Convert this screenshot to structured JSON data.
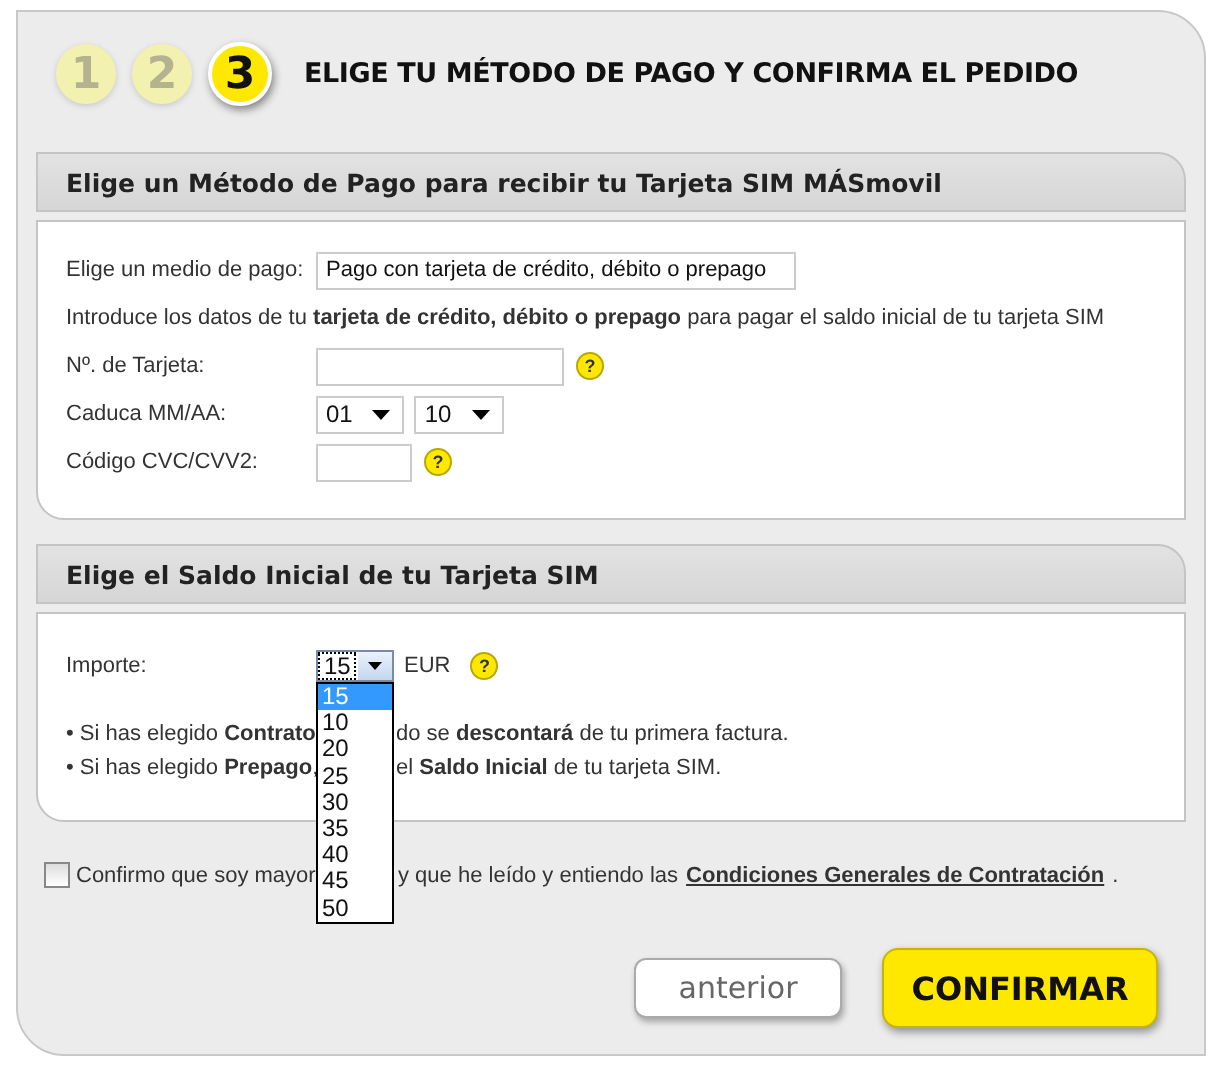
{
  "steps": [
    {
      "label": "1",
      "selected": false
    },
    {
      "label": "2",
      "selected": false
    },
    {
      "label": "3",
      "selected": true
    }
  ],
  "title": "ELIGE TU MÉTODO DE PAGO Y CONFIRMA EL PEDIDO",
  "payment_section": {
    "heading": "Elige un Método de Pago para recibir tu Tarjeta SIM MÁSmovil",
    "method": {
      "label": "Elige un medio de pago:",
      "value": "Pago con tarjeta de crédito, débito o prepago"
    },
    "instructions": "Introduce los datos de tu **tarjeta de crédito, débito o prepago** para pagar el saldo inicial de tu tarjeta SIM",
    "card_number": {
      "label": "Nº. de Tarjeta:",
      "help": "?"
    },
    "expiry": {
      "label": "Caduca MM/AA:",
      "month": "01",
      "year": "10"
    },
    "cvc": {
      "label": "Código CVC/CVV2:",
      "help": "?"
    }
  },
  "balance_section": {
    "heading": "Elige el Saldo Inicial de tu Tarjeta SIM",
    "amount": {
      "label": "Importe:",
      "value": "15",
      "unit": "EUR",
      "help": "?",
      "expanded": true,
      "options": [
        {
          "label": "15",
          "selected": true
        },
        {
          "label": "10",
          "selected": false
        },
        {
          "label": "20",
          "selected": false
        },
        {
          "label": "25",
          "selected": false
        },
        {
          "label": "30",
          "selected": false
        },
        {
          "label": "35",
          "selected": false
        },
        {
          "label": "40",
          "selected": false
        },
        {
          "label": "45",
          "selected": false
        },
        {
          "label": "50",
          "selected": false
        }
      ]
    },
    "notes": [
      {
        "before": "• Si has elegido **Contrato**",
        "after": "do se **descontará** de tu primera factura."
      },
      {
        "before": "• Si has elegido **Prepago**,",
        "after": "el **Saldo Inicial** de tu tarjeta SIM."
      }
    ]
  },
  "agreement": {
    "checked": false,
    "before": "Confirmo que soy mayor",
    "after": "y que he leído y entiendo las",
    "link": "Condiciones Generales de Contratación",
    "end": "."
  },
  "buttons": [
    {
      "label": "anterior",
      "kind": "secondary"
    },
    {
      "label": "CONFIRMAR",
      "kind": "primary"
    }
  ]
}
